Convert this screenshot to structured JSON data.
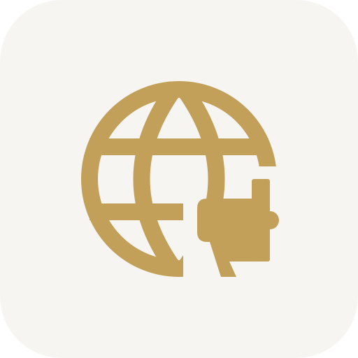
{
  "app_icon": {
    "icon_name": "globe-megaphone-icon",
    "colors": {
      "tile_background": "#f7f5f1",
      "glyph": "#c2a05a"
    }
  }
}
